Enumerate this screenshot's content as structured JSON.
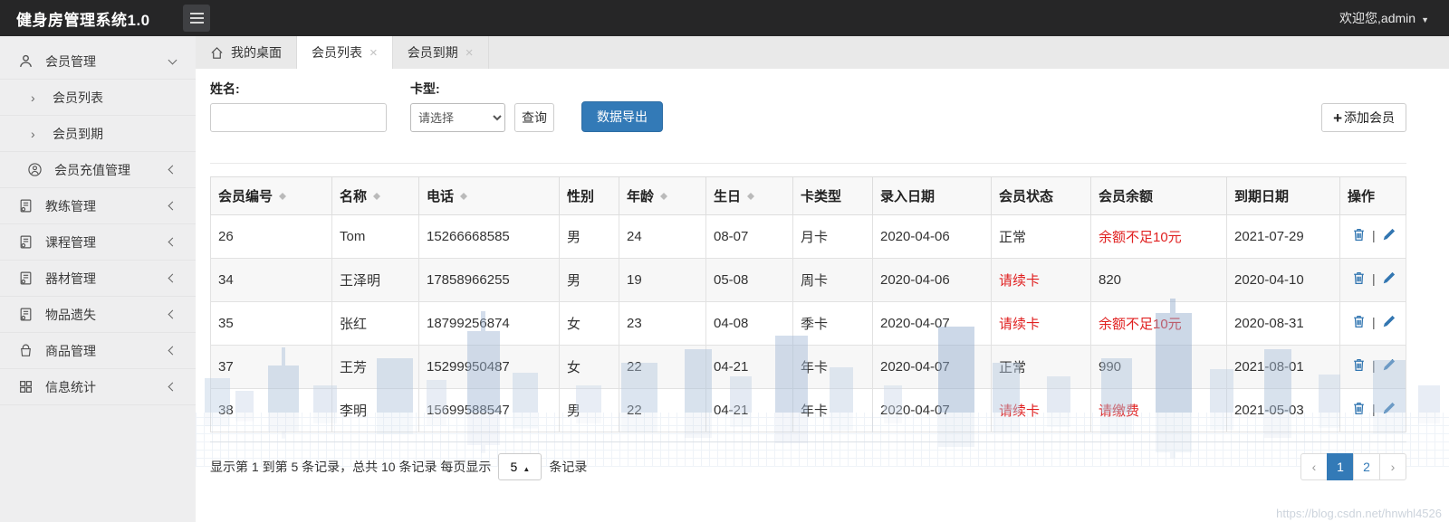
{
  "topbar": {
    "title": "健身房管理系统1.0",
    "welcome": "欢迎您,admin"
  },
  "sidebar": {
    "items": [
      {
        "label": "会员管理",
        "icon": "user-icon",
        "state": "expanded"
      },
      {
        "label": "会员列表",
        "icon": "chevron-right-icon"
      },
      {
        "label": "会员到期",
        "icon": "chevron-right-icon"
      },
      {
        "label": "会员充值管理",
        "icon": "user-badge-icon",
        "state": "collapsed"
      },
      {
        "label": "教练管理",
        "icon": "file-icon",
        "state": "collapsed"
      },
      {
        "label": "课程管理",
        "icon": "file-icon",
        "state": "collapsed"
      },
      {
        "label": "器材管理",
        "icon": "file-icon",
        "state": "collapsed"
      },
      {
        "label": "物品遗失",
        "icon": "file-icon",
        "state": "collapsed"
      },
      {
        "label": "商品管理",
        "icon": "bag-icon",
        "state": "collapsed"
      },
      {
        "label": "信息统计",
        "icon": "grid-icon",
        "state": "collapsed"
      }
    ]
  },
  "tabs": [
    {
      "label": "我的桌面",
      "active": false,
      "closable": false
    },
    {
      "label": "会员列表",
      "active": true,
      "closable": true
    },
    {
      "label": "会员到期",
      "active": false,
      "closable": true
    }
  ],
  "filters": {
    "name_label": "姓名:",
    "name_value": "",
    "card_label": "卡型:",
    "card_placeholder": "请选择",
    "search_button": "查询",
    "export_button": "数据导出",
    "add_button": "添加会员"
  },
  "table": {
    "ops_separator": "|",
    "headers": [
      {
        "label": "会员编号",
        "sortable": true
      },
      {
        "label": "名称",
        "sortable": true
      },
      {
        "label": "电话",
        "sortable": true
      },
      {
        "label": "性别",
        "sortable": false
      },
      {
        "label": "年龄",
        "sortable": true
      },
      {
        "label": "生日",
        "sortable": true
      },
      {
        "label": "卡类型",
        "sortable": false
      },
      {
        "label": "录入日期",
        "sortable": false
      },
      {
        "label": "会员状态",
        "sortable": false
      },
      {
        "label": "会员余额",
        "sortable": false
      },
      {
        "label": "到期日期",
        "sortable": false
      },
      {
        "label": "操作",
        "sortable": false
      }
    ],
    "rows": [
      {
        "id": "26",
        "name": "Tom",
        "phone": "15266668585",
        "gender": "男",
        "age": "24",
        "birthday": "08-07",
        "card_type": "月卡",
        "entry_date": "2020-04-06",
        "status": "正常",
        "status_class": "",
        "balance": "余额不足10元",
        "balance_class": "red",
        "expire_date": "2021-07-29"
      },
      {
        "id": "34",
        "name": "王泽明",
        "phone": "17858966255",
        "gender": "男",
        "age": "19",
        "birthday": "05-08",
        "card_type": "周卡",
        "entry_date": "2020-04-06",
        "status": "请续卡",
        "status_class": "red",
        "balance": "820",
        "balance_class": "",
        "expire_date": "2020-04-10"
      },
      {
        "id": "35",
        "name": "张红",
        "phone": "18799256874",
        "gender": "女",
        "age": "23",
        "birthday": "04-08",
        "card_type": "季卡",
        "entry_date": "2020-04-07",
        "status": "请续卡",
        "status_class": "red",
        "balance": "余额不足10元",
        "balance_class": "red",
        "expire_date": "2020-08-31"
      },
      {
        "id": "37",
        "name": "王芳",
        "phone": "15299950487",
        "gender": "女",
        "age": "22",
        "birthday": "04-21",
        "card_type": "年卡",
        "entry_date": "2020-04-07",
        "status": "正常",
        "status_class": "",
        "balance": "990",
        "balance_class": "",
        "expire_date": "2021-08-01"
      },
      {
        "id": "38",
        "name": "李明",
        "phone": "15699588547",
        "gender": "男",
        "age": "22",
        "birthday": "04-21",
        "card_type": "年卡",
        "entry_date": "2020-04-07",
        "status": "请续卡",
        "status_class": "red",
        "balance": "请缴费",
        "balance_class": "red",
        "expire_date": "2021-05-03"
      }
    ]
  },
  "pagination": {
    "info_prefix": "显示第 1 到第 5 条记录，总共 10 条记录 每页显示",
    "page_size": "5",
    "info_suffix": "条记录",
    "prev": "‹",
    "pages": [
      "1",
      "2"
    ],
    "next": "›",
    "active_page": "1"
  },
  "watermark_url": "https://blog.csdn.net/hnwhl4526",
  "colors": {
    "accent": "#337ab7",
    "danger": "#e02020",
    "icon_blue": "#3276b1",
    "topbar_bg": "#262627"
  }
}
